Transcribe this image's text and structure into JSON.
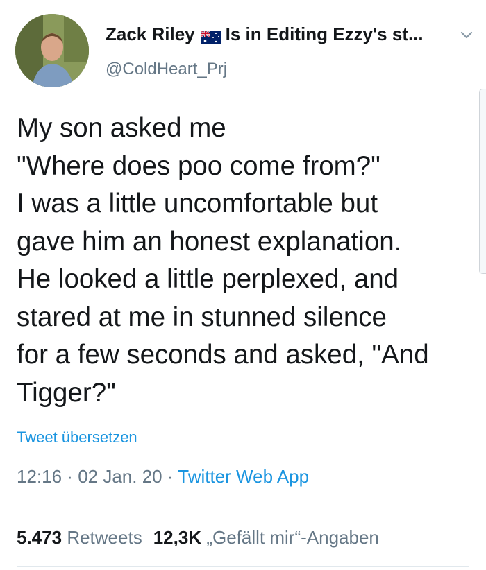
{
  "user": {
    "display_name": "Zack Riley",
    "name_suffix": "Is in Editing Ezzy's st...",
    "handle": "@ColdHeart_Prj",
    "flag_icon": "australia-flag-icon"
  },
  "tweet": {
    "lines": [
      "My son asked me",
      "\"Where does poo come from?\"",
      "I was a little uncomfortable but",
      "gave him an honest explanation.",
      "He looked a little perplexed, and",
      "stared at me in stunned silence",
      "for a few seconds and asked, \"And",
      "Tigger?\""
    ],
    "translate_label": "Tweet übersetzen"
  },
  "meta": {
    "time": "12:16",
    "date": "02 Jan. 20",
    "separator": " · ",
    "app": "Twitter Web App"
  },
  "stats": {
    "retweets_count": "5.473",
    "retweets_label": "Retweets",
    "likes_count": "12,3K",
    "likes_label": "„Gefällt mir“-Angaben"
  },
  "colors": {
    "link": "#1b95e0",
    "secondary": "#657786",
    "text": "#14171a"
  }
}
